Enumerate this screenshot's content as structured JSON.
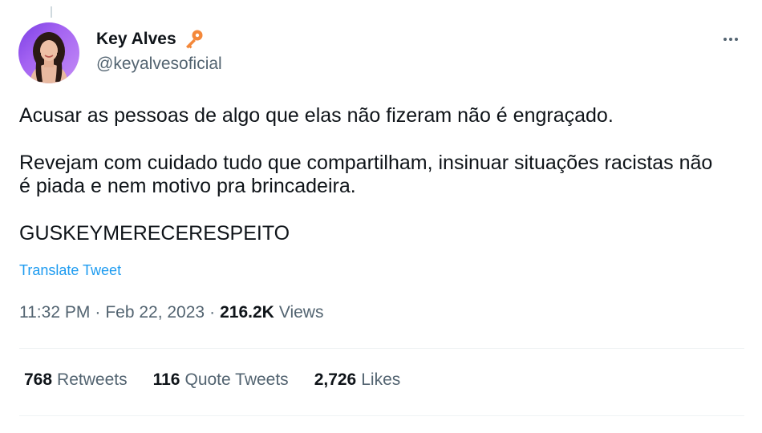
{
  "author": {
    "display_name": "Key Alves",
    "handle": "@keyalvesoficial",
    "badge_icon": "key-icon",
    "avatar_colors": [
      "#7b3fe4",
      "#c38cf5"
    ]
  },
  "tweet": {
    "paragraphs": [
      "Acusar as pessoas de algo que elas não fizeram não é engraçado.",
      "Revejam com cuidado tudo que compartilham, insinuar situações racistas não é piada e nem motivo pra brincadeira.",
      "GUSKEYMERECERESPEITO"
    ],
    "translate_label": "Translate Tweet"
  },
  "meta": {
    "time": "11:32 PM",
    "separator": "·",
    "date": "Feb 22, 2023",
    "views_count": "216.2K",
    "views_label": "Views"
  },
  "stats": {
    "retweets_count": "768",
    "retweets_label": "Retweets",
    "quotes_count": "116",
    "quotes_label": "Quote Tweets",
    "likes_count": "2,726",
    "likes_label": "Likes"
  },
  "colors": {
    "link": "#1d9bf0",
    "secondary_text": "#536471",
    "primary_text": "#0f1419",
    "key_icon": "#f4883a"
  }
}
